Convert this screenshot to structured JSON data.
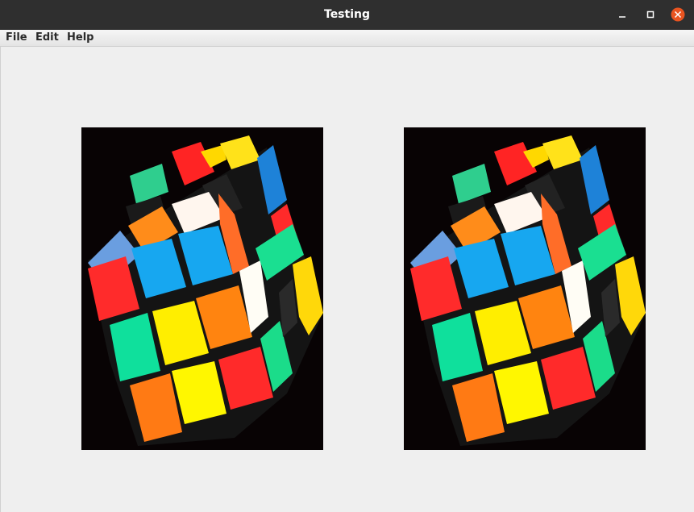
{
  "window": {
    "title": "Testing",
    "colors": {
      "titlebar": "#2f2f2f",
      "close": "#e95420",
      "background": "#efefef"
    }
  },
  "menubar": {
    "items": [
      {
        "label": "File"
      },
      {
        "label": "Edit"
      },
      {
        "label": "Help"
      }
    ]
  },
  "images": [
    {
      "name": "rubiks-cube-photo",
      "icon": "rubiks-cube-image"
    },
    {
      "name": "rubiks-cube-photo-copy",
      "icon": "rubiks-cube-image"
    }
  ]
}
